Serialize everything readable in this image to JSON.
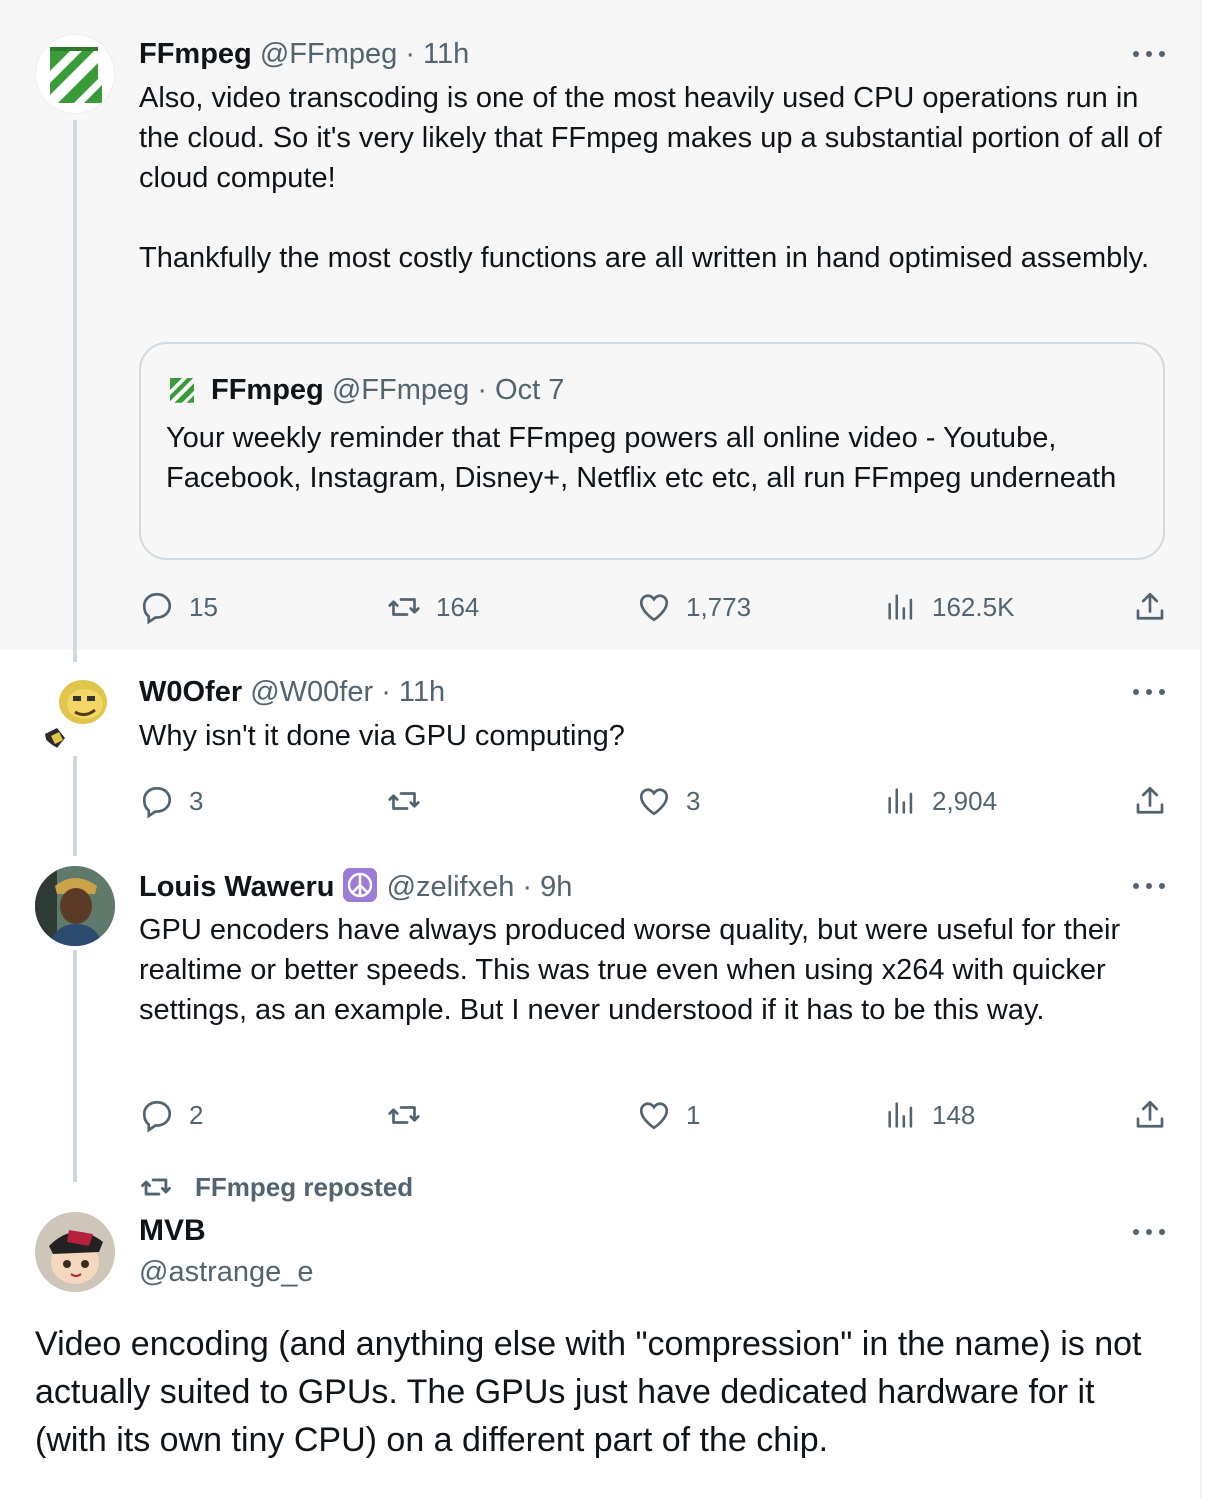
{
  "colors": {
    "text": "#0f1419",
    "secondary": "#536471",
    "thread_line": "#cfd9de",
    "highlight_bg": "#f7f7f7",
    "ffmpeg_green": "#3a9b39"
  },
  "main_tweet": {
    "name": "FFmpeg",
    "handle": "@FFmpeg",
    "time": "· 11h",
    "avatar_icon": "ffmpeg-logo",
    "paragraphs": [
      "Also, video transcoding is one of the most heavily used CPU operations run in the cloud. So it's very likely that FFmpeg makes up a substantial portion of all of cloud compute!",
      "Thankfully the most costly functions are all written in hand optimised assembly."
    ],
    "quote": {
      "name": "FFmpeg",
      "handle": "@FFmpeg",
      "time": "· Oct 7",
      "text": "Your weekly reminder that FFmpeg powers all online video - Youtube, Facebook, Instagram, Disney+, Netflix etc etc, all run FFmpeg underneath"
    },
    "stats": {
      "replies": "15",
      "reposts": "164",
      "likes": "1,773",
      "views": "162.5K"
    }
  },
  "reply1": {
    "name": "W0Ofer",
    "handle": "@W00fer",
    "time": "· 11h",
    "text": "Why isn't it done via GPU computing?",
    "stats": {
      "replies": "3",
      "reposts": "",
      "likes": "3",
      "views": "2,904"
    }
  },
  "reply2": {
    "name": "Louis Waweru",
    "badge_icon": "peace-icon",
    "handle": "@zelifxeh",
    "time": "· 9h",
    "text": "GPU encoders have always produced worse quality,  but were useful for their realtime or better speeds. This was true even when using x264 with quicker settings, as an example. But I never understood if it has to be this way.",
    "stats": {
      "replies": "2",
      "reposts": "",
      "likes": "1",
      "views": "148"
    }
  },
  "repost": {
    "label": "FFmpeg reposted",
    "name": "MVB",
    "handle": "@astrange_e",
    "text": "Video encoding (and anything else with \"compression\" in the name) is not actually suited to GPUs. The GPUs just have dedicated hardware for it (with its own tiny CPU) on a different part of the chip."
  }
}
